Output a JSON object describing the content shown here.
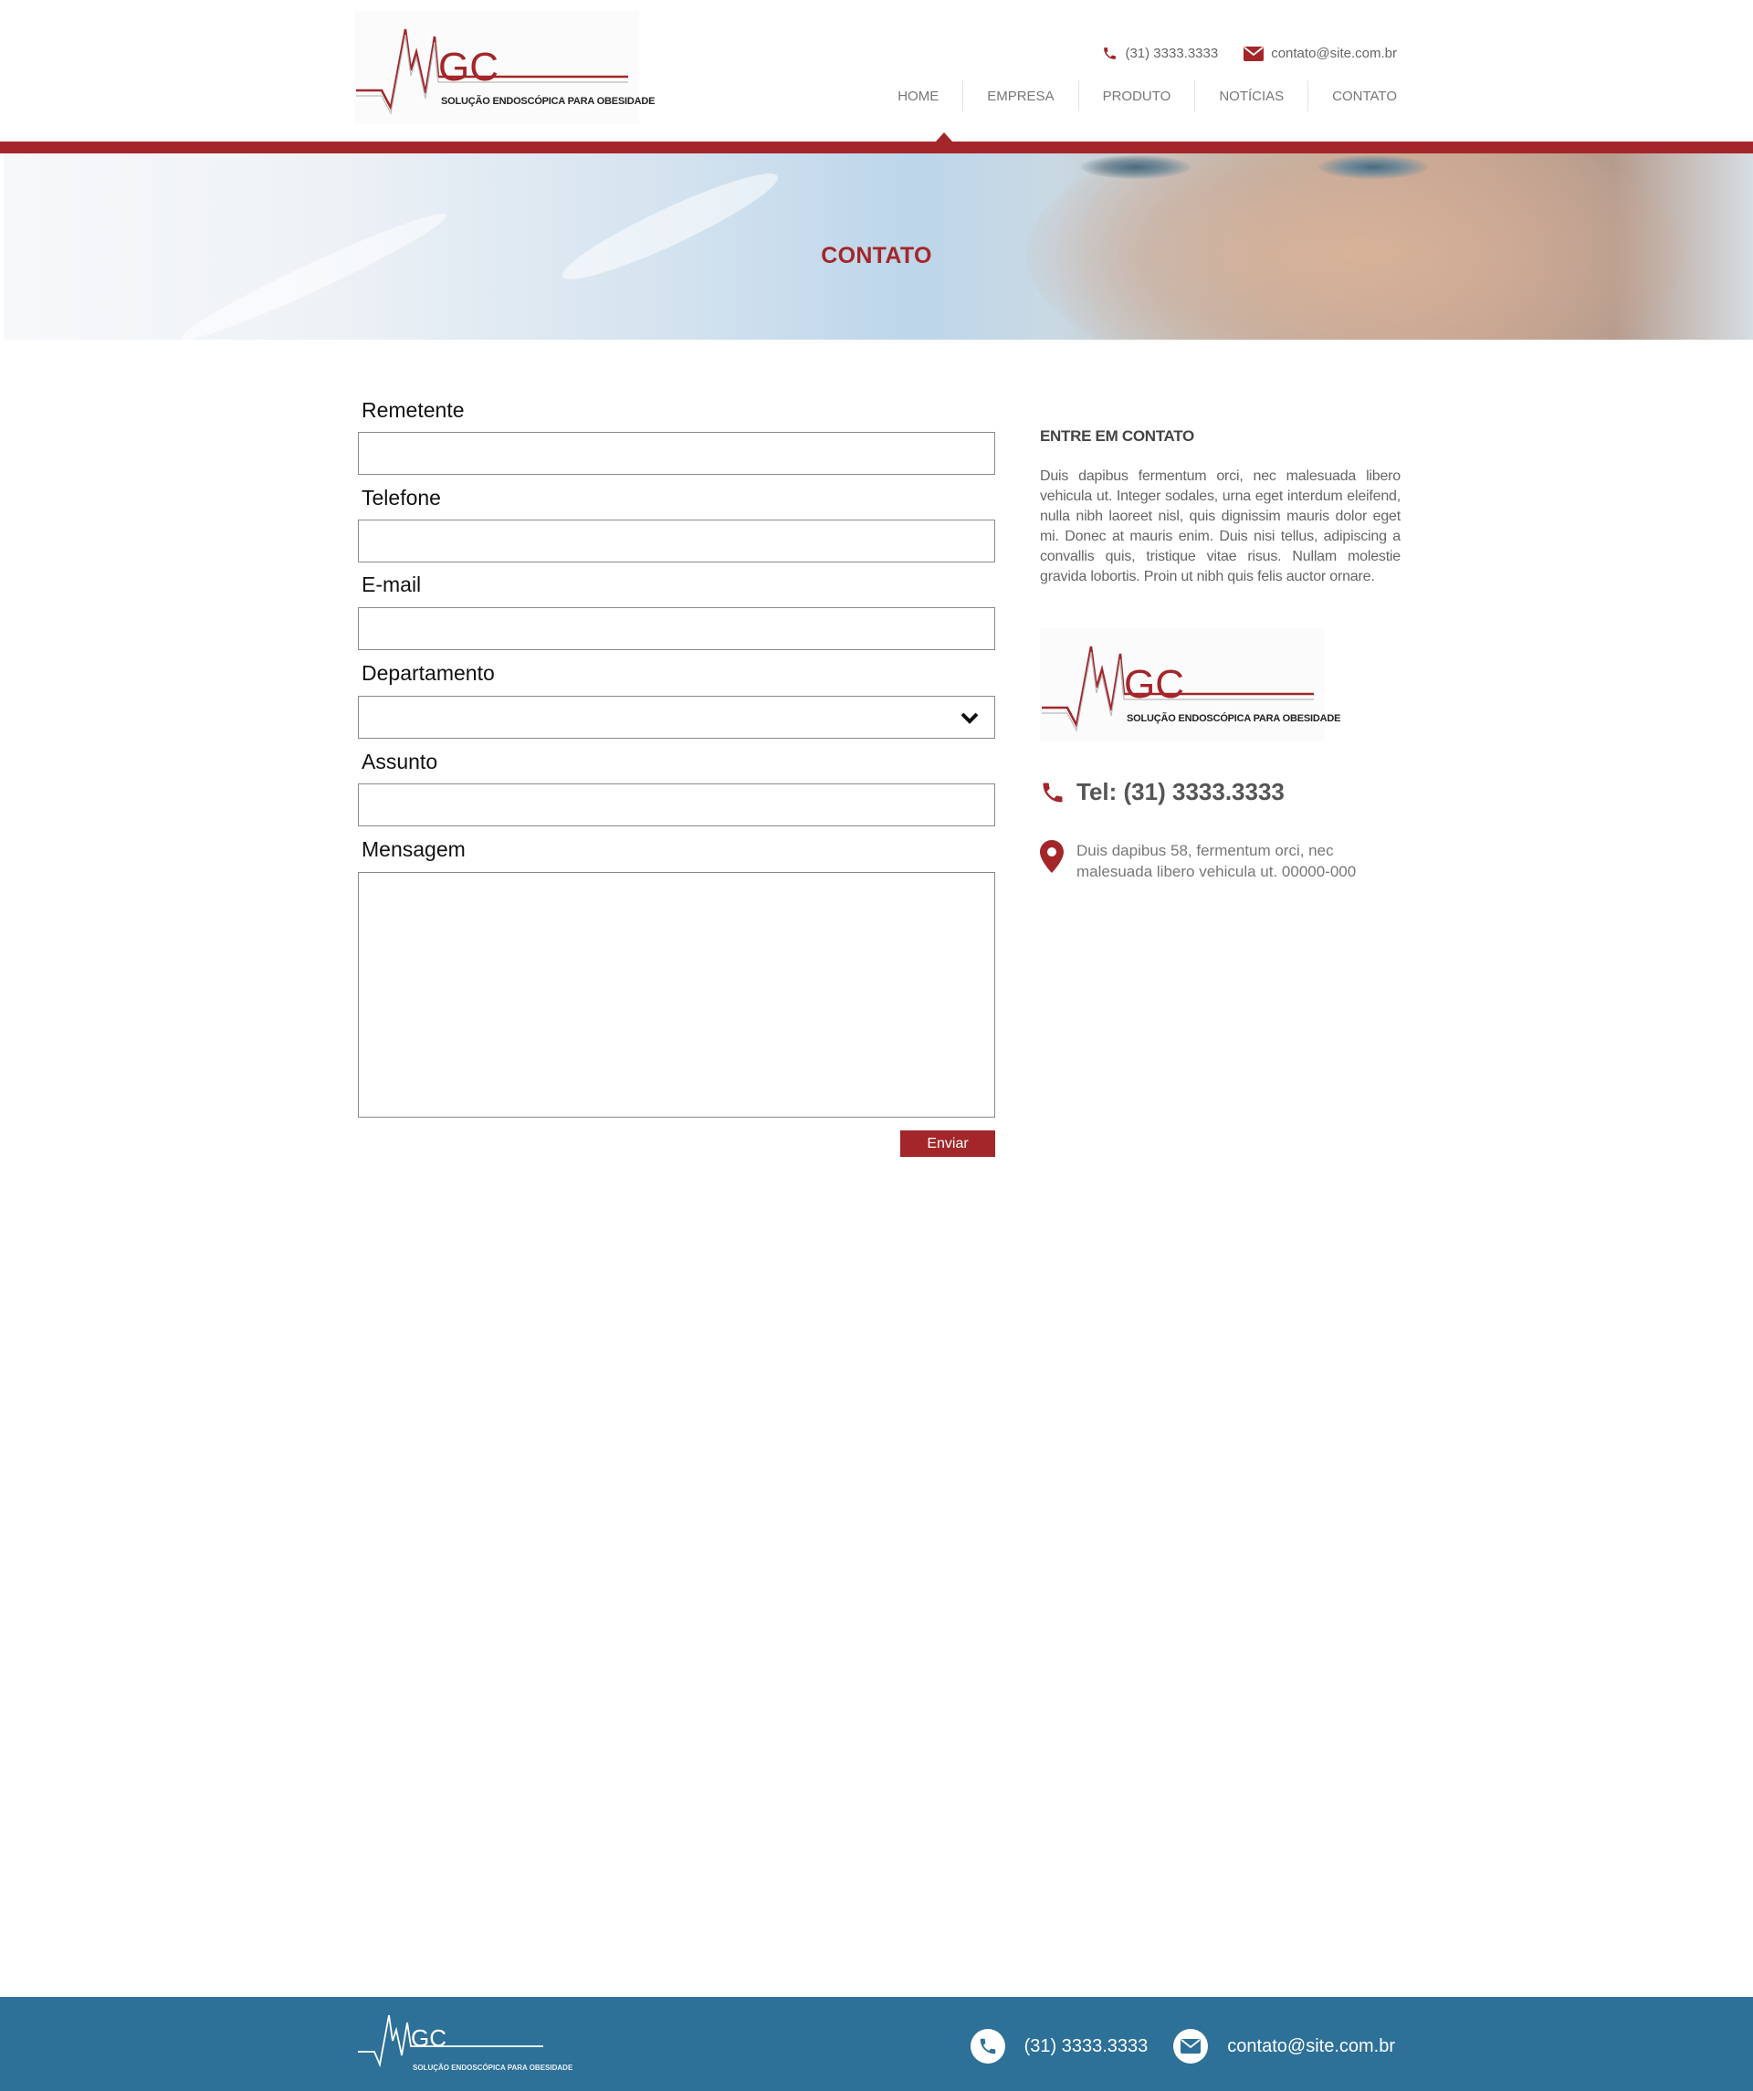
{
  "brand": {
    "logo_text": "GC",
    "tagline": "SOLUÇÃO ENDOSCÓPICA PARA OBESIDADE"
  },
  "header": {
    "phone": "(31) 3333.3333",
    "email": "contato@site.com.br",
    "nav": [
      {
        "label": "HOME"
      },
      {
        "label": "EMPRESA"
      },
      {
        "label": "PRODUTO"
      },
      {
        "label": "NOTÍCIAS"
      },
      {
        "label": "CONTATO"
      }
    ]
  },
  "banner": {
    "title": "CONTATO"
  },
  "form": {
    "fields": [
      {
        "label": "Remetente",
        "value": ""
      },
      {
        "label": "Telefone",
        "value": ""
      },
      {
        "label": "E-mail",
        "value": ""
      },
      {
        "label": "Departamento",
        "value": ""
      },
      {
        "label": "Assunto",
        "value": ""
      },
      {
        "label": "Mensagem",
        "value": ""
      }
    ],
    "submit_label": "Enviar"
  },
  "sidebar": {
    "title": "ENTRE EM CONTATO",
    "text": "Duis dapibus fermentum orci, nec malesuada libero vehicula ut. Integer sodales, urna eget interdum eleifend, nulla nibh laoreet nisl, quis dignissim mauris dolor eget mi. Donec at mauris enim. Duis nisi tellus, adipiscing a convallis quis, tristique vitae risus. Nullam molestie gravida lobortis. Proin ut nibh quis felis auctor ornare.",
    "tel": "Tel: (31) 3333.3333",
    "address": "Duis dapibus 58, fermentum orci, nec malesuada libero vehicula ut. 00000-000"
  },
  "footer": {
    "phone": "(31) 3333.3333",
    "email": "contato@site.com.br"
  },
  "colors": {
    "accent": "#a3262a",
    "footer_bg": "#2d7098"
  },
  "icons": [
    "phone-icon",
    "mail-icon",
    "location-pin-icon",
    "chevron-down-icon"
  ]
}
